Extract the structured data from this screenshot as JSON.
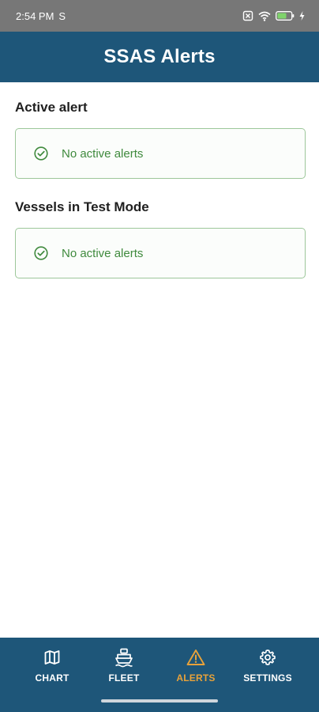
{
  "status_bar": {
    "time": "2:54 PM",
    "extra_icon": "S"
  },
  "header": {
    "title": "SSAS Alerts"
  },
  "sections": [
    {
      "title": "Active alert",
      "message": "No active alerts"
    },
    {
      "title": "Vessels in Test Mode",
      "message": "No active alerts"
    }
  ],
  "bottom_nav": {
    "items": [
      {
        "label": "CHART",
        "icon": "map-icon"
      },
      {
        "label": "FLEET",
        "icon": "ship-icon"
      },
      {
        "label": "ALERTS",
        "icon": "warning-icon",
        "active": true
      },
      {
        "label": "SETTINGS",
        "icon": "gear-icon"
      }
    ]
  },
  "colors": {
    "primary": "#1e5679",
    "active_tab": "#e8a23a",
    "success": "#3f8a3d"
  }
}
